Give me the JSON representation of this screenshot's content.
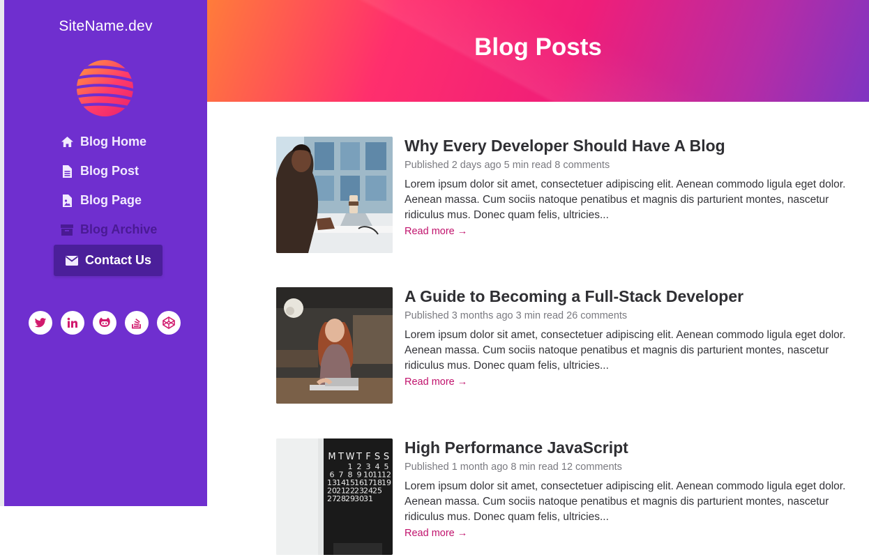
{
  "sidebar": {
    "site_name": "SiteName.dev",
    "nav": [
      {
        "label": "Blog Home",
        "icon": "home-icon"
      },
      {
        "label": "Blog Post",
        "icon": "file-icon"
      },
      {
        "label": "Blog Page",
        "icon": "file-image-icon"
      },
      {
        "label": "Blog Archive",
        "icon": "archive-icon"
      },
      {
        "label": "Contact Us",
        "icon": "envelope-icon"
      }
    ],
    "socials": [
      "twitter-icon",
      "linkedin-icon",
      "github-icon",
      "stackoverflow-icon",
      "codepen-icon"
    ]
  },
  "header": {
    "title": "Blog Posts"
  },
  "posts": [
    {
      "title": "Why Every Developer Should Have A Blog",
      "meta": "Published 2 days ago 5 min read 8 comments",
      "excerpt": "Lorem ipsum dolor sit amet, consectetuer adipiscing elit. Aenean commodo ligula eget dolor. Aenean massa. Cum sociis natoque penatibus et magnis dis parturient montes, nascetur ridiculus mus. Donec quam felis, ultricies...",
      "read_more": "Read more →"
    },
    {
      "title": "A Guide to Becoming a Full-Stack Developer",
      "meta": "Published 3 months ago 3 min read 26 comments",
      "excerpt": "Lorem ipsum dolor sit amet, consectetuer adipiscing elit. Aenean commodo ligula eget dolor. Aenean massa. Cum sociis natoque penatibus et magnis dis parturient montes, nascetur ridiculus mus. Donec quam felis, ultricies...",
      "read_more": "Read more →"
    },
    {
      "title": "High Performance JavaScript",
      "meta": "Published 1 month ago 8 min read 12 comments",
      "excerpt": "Lorem ipsum dolor sit amet, consectetuer adipiscing elit. Aenean commodo ligula eget dolor. Aenean massa. Cum sociis natoque penatibus et magnis dis parturient montes, nascetur ridiculus mus. Donec quam felis, ultricies...",
      "read_more": "Read more →"
    }
  ],
  "calendar": {
    "days": [
      "M",
      "T",
      "W",
      "T",
      "F",
      "S",
      "S"
    ],
    "rows": [
      [
        "",
        "",
        "1",
        "2",
        "3",
        "4",
        "5"
      ],
      [
        "6",
        "7",
        "8",
        "9",
        "10",
        "11",
        "12"
      ],
      [
        "13",
        "14",
        "15",
        "16",
        "17",
        "18",
        "19"
      ],
      [
        "20",
        "21",
        "22",
        "23",
        "24",
        "25",
        ""
      ],
      [
        "27",
        "28",
        "29",
        "30",
        "31",
        "",
        ""
      ]
    ]
  },
  "colors": {
    "sidebar": "#6f2fcf",
    "accent": "#c0126c",
    "active_nav": "#4b1f9a"
  }
}
